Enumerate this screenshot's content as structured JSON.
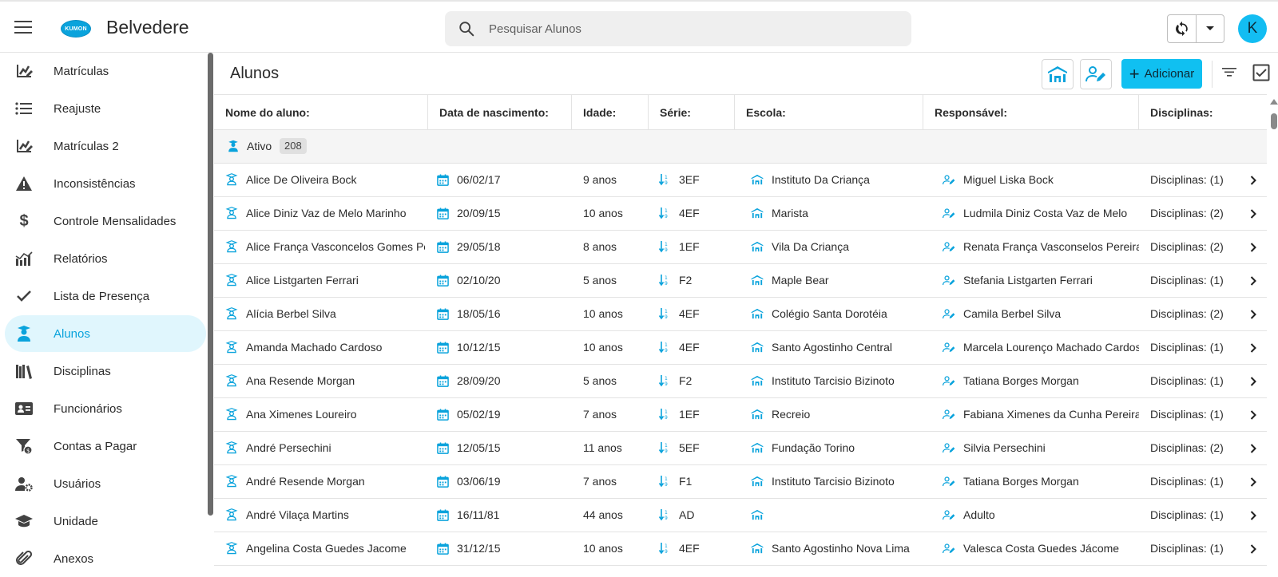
{
  "header": {
    "unit_name": "Belvedere",
    "logo_text": "KUMON",
    "search_placeholder": "Pesquisar Alunos",
    "avatar_letter": "K"
  },
  "sidebar": {
    "items": [
      {
        "label": "Matrículas",
        "icon": "edit-chart-icon"
      },
      {
        "label": "Reajuste",
        "icon": "list-icon"
      },
      {
        "label": "Matrículas 2",
        "icon": "edit-chart-icon"
      },
      {
        "label": "Inconsistências",
        "icon": "warning-icon"
      },
      {
        "label": "Controle Mensalidades",
        "icon": "dollar-icon"
      },
      {
        "label": "Relatórios",
        "icon": "chart-icon"
      },
      {
        "label": "Lista de Presença",
        "icon": "check-icon"
      },
      {
        "label": "Alunos",
        "icon": "student-icon",
        "active": true
      },
      {
        "label": "Disciplinas",
        "icon": "books-icon"
      },
      {
        "label": "Funcionários",
        "icon": "id-card-icon"
      },
      {
        "label": "Contas a Pagar",
        "icon": "funnel-money-icon"
      },
      {
        "label": "Usuários",
        "icon": "user-gear-icon"
      },
      {
        "label": "Unidade",
        "icon": "graduation-cap-icon"
      },
      {
        "label": "Anexos",
        "icon": "paperclip-icon"
      }
    ]
  },
  "main": {
    "title": "Alunos",
    "add_label": "Adicionar",
    "columns": [
      "Nome do aluno:",
      "Data de nascimento:",
      "Idade:",
      "Série:",
      "Escola:",
      "Responsável:",
      "Disciplinas:"
    ],
    "group": {
      "label": "Ativo",
      "count": "208"
    },
    "rows": [
      {
        "name": "Alice De Oliveira Bock",
        "birth": "06/02/17",
        "age": "9 anos",
        "grade": "3EF",
        "school": "Instituto Da Criança",
        "guardian": "Miguel Liska Bock",
        "subjects": "Disciplinas: (1)"
      },
      {
        "name": "Alice Diniz Vaz de Melo Marinho",
        "birth": "20/09/15",
        "age": "10 anos",
        "grade": "4EF",
        "school": "Marista",
        "guardian": "Ludmila Diniz Costa Vaz de Melo",
        "subjects": "Disciplinas: (2)"
      },
      {
        "name": "Alice França Vasconcelos Gomes Per...",
        "birth": "29/05/18",
        "age": "8 anos",
        "grade": "1EF",
        "school": "Vila Da Criança",
        "guardian": "Renata França Vasconselos Pereira",
        "subjects": "Disciplinas: (2)"
      },
      {
        "name": "Alice Listgarten Ferrari",
        "birth": "02/10/20",
        "age": "5 anos",
        "grade": "F2",
        "school": "Maple Bear",
        "guardian": "Stefania Listgarten Ferrari",
        "subjects": "Disciplinas: (1)"
      },
      {
        "name": "Alícia Berbel Silva",
        "birth": "18/05/16",
        "age": "10 anos",
        "grade": "4EF",
        "school": "Colégio Santa Dorotéia",
        "guardian": "Camila Berbel Silva",
        "subjects": "Disciplinas: (2)"
      },
      {
        "name": "Amanda Machado Cardoso",
        "birth": "10/12/15",
        "age": "10 anos",
        "grade": "4EF",
        "school": "Santo Agostinho Central",
        "guardian": "Marcela Lourenço Machado Cardoso",
        "subjects": "Disciplinas: (1)"
      },
      {
        "name": "Ana Resende Morgan",
        "birth": "28/09/20",
        "age": "5 anos",
        "grade": "F2",
        "school": "Instituto Tarcisio Bizinoto",
        "guardian": "Tatiana Borges Morgan",
        "subjects": "Disciplinas: (1)"
      },
      {
        "name": "Ana Ximenes Loureiro",
        "birth": "05/02/19",
        "age": "7 anos",
        "grade": "1EF",
        "school": "Recreio",
        "guardian": "Fabiana Ximenes da Cunha Pereira Lou",
        "subjects": "Disciplinas: (1)"
      },
      {
        "name": "André Persechini",
        "birth": "12/05/15",
        "age": "11 anos",
        "grade": "5EF",
        "school": "Fundação Torino",
        "guardian": "Silvia Persechini",
        "subjects": "Disciplinas: (2)"
      },
      {
        "name": "André Resende Morgan",
        "birth": "03/06/19",
        "age": "7 anos",
        "grade": "F1",
        "school": "Instituto Tarcisio Bizinoto",
        "guardian": "Tatiana Borges Morgan",
        "subjects": "Disciplinas: (1)"
      },
      {
        "name": "André Vilaça Martins",
        "birth": "16/11/81",
        "age": "44 anos",
        "grade": "AD",
        "school": "",
        "guardian": "Adulto",
        "subjects": "Disciplinas: (1)"
      },
      {
        "name": "Angelina Costa Guedes Jacome",
        "birth": "31/12/15",
        "age": "10 anos",
        "grade": "4EF",
        "school": "Santo Agostinho Nova Lima",
        "guardian": "Valesca Costa Guedes Jácome",
        "subjects": "Disciplinas: (1)"
      }
    ]
  },
  "colors": {
    "accent": "#10c0f1",
    "icon_accent": "#0aa3dc",
    "active_bg": "#e0f6fd"
  }
}
